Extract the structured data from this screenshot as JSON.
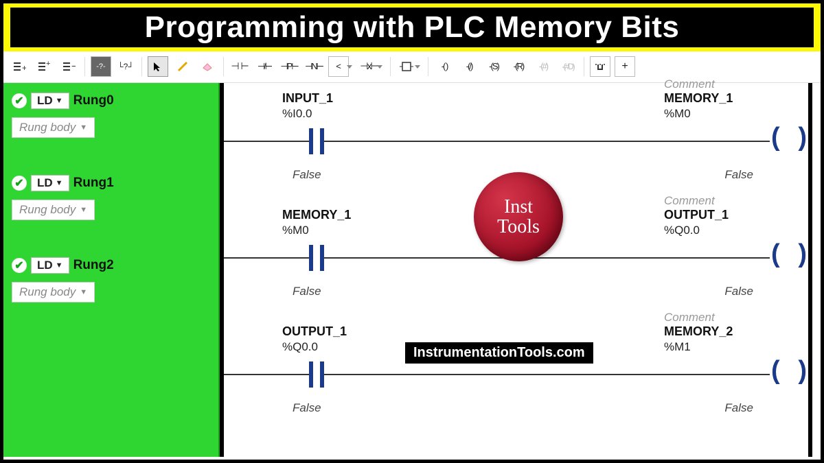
{
  "header": {
    "title": "Programming with PLC Memory Bits"
  },
  "toolbar": {
    "comment1": "-?-",
    "comment2": "└?┘"
  },
  "sidebar": {
    "ld_label": "LD",
    "body_label": "Rung body",
    "rungs": [
      {
        "name": "Rung0"
      },
      {
        "name": "Rung1"
      },
      {
        "name": "Rung2"
      }
    ]
  },
  "ladder": {
    "comment_label": "Comment",
    "rows": [
      {
        "input": {
          "name": "INPUT_1",
          "addr": "%I0.0",
          "state": "False"
        },
        "output": {
          "name": "MEMORY_1",
          "addr": "%M0",
          "state": "False"
        }
      },
      {
        "input": {
          "name": "MEMORY_1",
          "addr": "%M0",
          "state": "False"
        },
        "output": {
          "name": "OUTPUT_1",
          "addr": "%Q0.0",
          "state": "False"
        }
      },
      {
        "input": {
          "name": "OUTPUT_1",
          "addr": "%Q0.0",
          "state": "False"
        },
        "output": {
          "name": "MEMORY_2",
          "addr": "%M1",
          "state": "False"
        }
      }
    ]
  },
  "branding": {
    "logo_line1": "Inst",
    "logo_line2": "Tools",
    "site": "InstrumentationTools.com"
  }
}
